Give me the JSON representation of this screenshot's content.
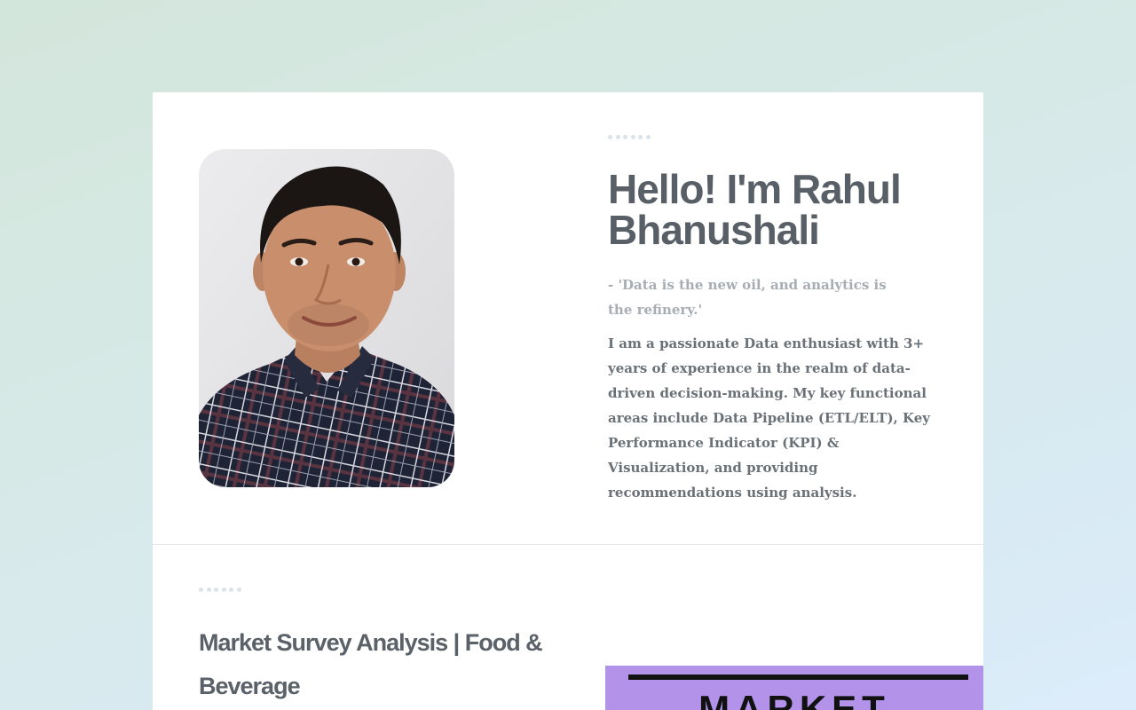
{
  "hero": {
    "title": "Hello! I'm Rahul Bhanushali",
    "quote": "- 'Data is the new oil, and analytics is the refinery.'",
    "bio": "I am a passionate Data enthusiast with 3+ years of experience in the realm of data-driven decision-making. My key functional areas include Data Pipeline (ETL/ELT), Key Performance Indicator (KPI) & Visualization, and providing recommendations using analysis."
  },
  "project": {
    "title": "Market Survey Analysis | Food & Beverage",
    "thumbnail_text": "MARKET",
    "thumbnail_color": "#b293e9"
  },
  "colors": {
    "heading": "#585f66",
    "quote": "#a7adb3",
    "body": "#6a7177",
    "dots": "#dbe3ea"
  }
}
